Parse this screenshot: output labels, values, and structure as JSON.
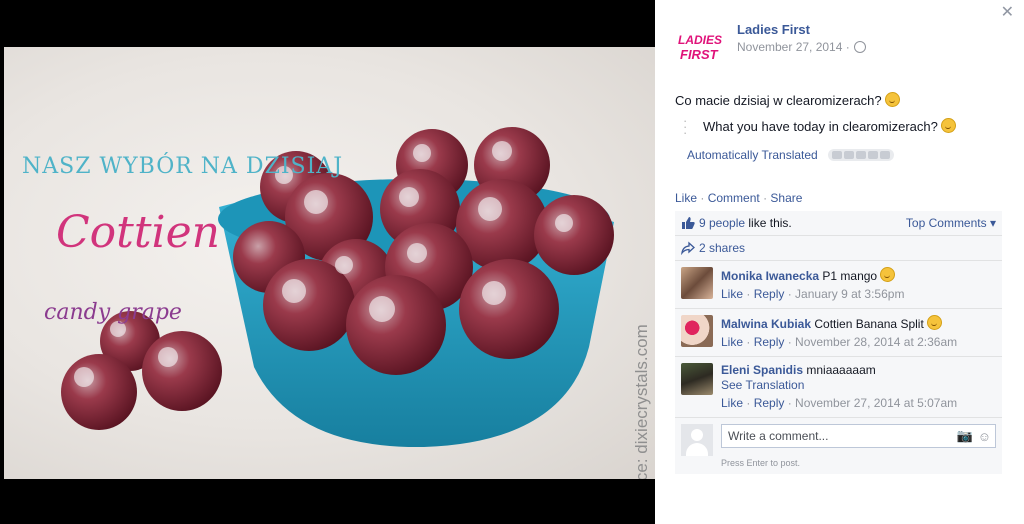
{
  "photo": {
    "title": "NASZ WYBÓR NA DZISIAJ",
    "brand": "Cottien",
    "subtitle": "candy grape",
    "source": "Source: dixiecrystals.com"
  },
  "post": {
    "close_icon": "close-icon",
    "page_name": "Ladies First",
    "logo_text_line1": "LADIES",
    "logo_text_line2": "FIRST",
    "date": "November 27, 2014 ·",
    "text": "Co macie dzisiaj w clearomizerach?",
    "translation": "What you have today in clearomizerach?",
    "auto_translated": "Automatically Translated"
  },
  "actions": {
    "like": "Like",
    "comment": "Comment",
    "share": "Share",
    "sep": "·"
  },
  "ufi": {
    "likes_link": "9 people",
    "likes_suffix": "like this.",
    "top_comments": "Top Comments",
    "shares": "2 shares"
  },
  "comments": [
    {
      "name": "Monika Iwanecka",
      "text": "P1 mango",
      "like": "Like",
      "reply": "Reply",
      "time": "January 9 at 3:56pm",
      "emoji": true
    },
    {
      "name": "Malwina Kubiak",
      "text": "Cottien Banana Split",
      "like": "Like",
      "reply": "Reply",
      "time": "November 28, 2014 at 2:36am",
      "emoji": true
    },
    {
      "name": "Eleni Spanidis",
      "text": "mniaaaaaam",
      "see_translation": "See Translation",
      "like": "Like",
      "reply": "Reply",
      "time": "November 27, 2014 at 5:07am",
      "emoji": false
    }
  ],
  "composer": {
    "placeholder": "Write a comment...",
    "hint": "Press Enter to post."
  },
  "colors": {
    "link": "#3b5998",
    "bowl": "#2ea3c7",
    "grape": "#7a1f2c",
    "title_teal": "#4fb3c8",
    "brand_pink": "#d1347c"
  }
}
